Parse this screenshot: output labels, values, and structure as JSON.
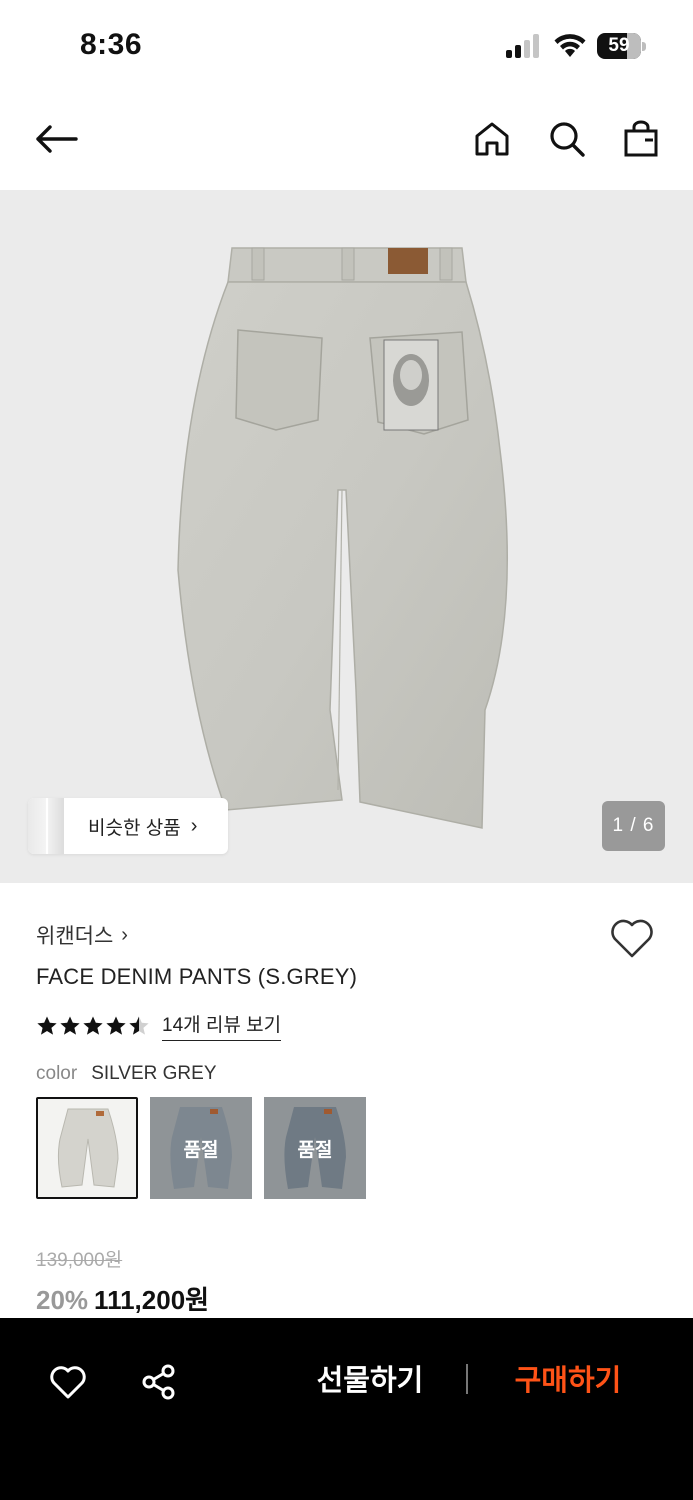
{
  "status_bar": {
    "time": "8:36",
    "battery": "59"
  },
  "gallery": {
    "similar_label": "비슷한 상품",
    "current_page": "1",
    "total_pages": "6",
    "page_text": "1 / 6"
  },
  "product": {
    "brand": "위캔더스",
    "title": "FACE DENIM PANTS (S.GREY)",
    "rating": 4.5,
    "review_link": "14개 리뷰 보기",
    "color_label": "color",
    "color_value": "SILVER GREY",
    "swatches": [
      {
        "name": "SILVER GREY",
        "status": ""
      },
      {
        "name": "",
        "status": "품절"
      },
      {
        "name": "",
        "status": "품절"
      }
    ],
    "original_price": "139,000원",
    "discount": "20%",
    "sale_price": "111,200원"
  },
  "bottom_bar": {
    "gift_label": "선물하기",
    "buy_label": "구매하기",
    "buy_color": "#ff5317"
  },
  "icons": [
    "back-arrow-icon",
    "home-icon",
    "search-icon",
    "shopping-bag-icon",
    "heart-icon",
    "share-icon",
    "star-icon",
    "chevron-right-icon"
  ]
}
